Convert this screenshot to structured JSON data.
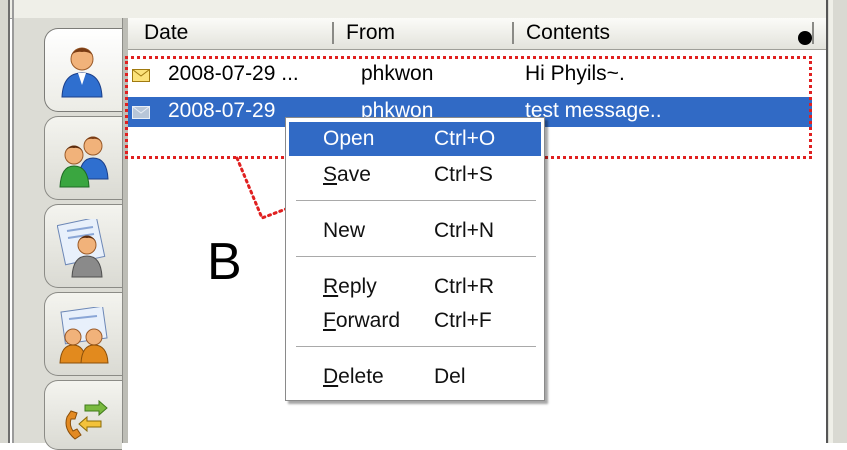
{
  "columns": {
    "date": "Date",
    "from": "From",
    "contents": "Contents"
  },
  "messages": [
    {
      "date": "2008-07-29 ...",
      "from": "phkwon",
      "contents": "Hi Phyils~."
    },
    {
      "date": "2008-07-29",
      "from": "phkwon",
      "contents": "test message.."
    }
  ],
  "context_menu": {
    "open": {
      "label": "Open",
      "shortcut": "Ctrl+O"
    },
    "save": {
      "label": "Save",
      "shortcut": "Ctrl+S"
    },
    "new": {
      "label": "New",
      "shortcut": "Ctrl+N"
    },
    "reply": {
      "label": "Reply",
      "shortcut": "Ctrl+R"
    },
    "forward": {
      "label": "Forward",
      "shortcut": "Ctrl+F"
    },
    "delete": {
      "label": "Delete",
      "shortcut": "Del"
    }
  },
  "annotation": {
    "label": "B"
  },
  "colors": {
    "selection": "#316ac5",
    "annotation_outline": "#e02020"
  },
  "icons": [
    "contact-icon",
    "group-icon",
    "message-board-icon",
    "chat-icon",
    "phone-transfer-icon",
    "mail-icon"
  ]
}
